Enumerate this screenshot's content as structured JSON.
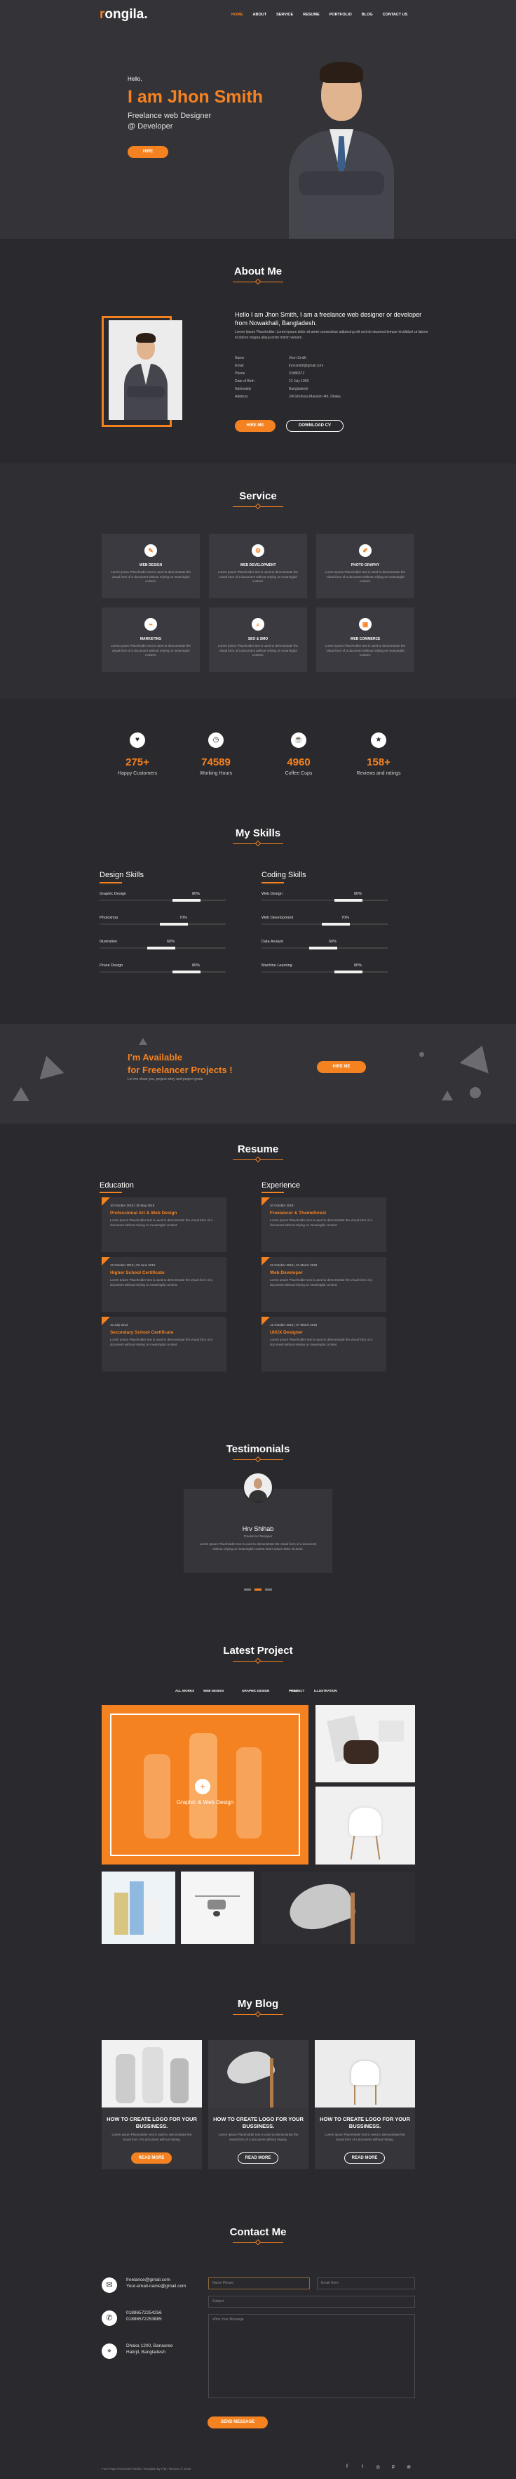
{
  "brand": {
    "logo_first": "r",
    "logo_rest": "ongila."
  },
  "nav": [
    "HOME",
    "ABOUT",
    "SERVICE",
    "RESUME",
    "PORTFOLIO",
    "BLOG",
    "CONTACT US"
  ],
  "hero": {
    "hello": "Hello,",
    "name": "I am Jhon Smith",
    "sub1": "Freelance web Designer",
    "sub2": "@ Developer",
    "button": "HIRE"
  },
  "about": {
    "title": "About Me",
    "intro": "Hello I am Jhon Smith, I am a freelance web designer or developer from Nowakhali, Bangladesh.",
    "text": "Lorem Ipsum Placeholder. Lorem ipsum dolor sit amet consectetur adipiscing elit sed do eiusmod tempor incididunt ut labore et dolore magna aliqua enim minim veniam.",
    "rows": [
      {
        "k": "Name",
        "v": "Jhon Smith"
      },
      {
        "k": "Email",
        "v": "jhonsmith@gmail.com"
      },
      {
        "k": "Phone",
        "v": "01886572"
      },
      {
        "k": "Date of Birth",
        "v": "12 July 1990"
      },
      {
        "k": "Nationality",
        "v": "Bangladeshi"
      },
      {
        "k": "Address",
        "v": "2/4 Ghohora Mansion 4th, Dhaka"
      }
    ],
    "btn1": "HIRE ME",
    "btn2": "DOWNLOAD CV"
  },
  "service": {
    "title": "Service",
    "desc": "Lorem Ipsum Placeholder text is used to demonstrate the visual form of a document without relying on meaningful content.",
    "items": [
      {
        "icon": "✎",
        "label": "WEB DESIGN"
      },
      {
        "icon": "⚙",
        "label": "WEB DEVELOPMENT"
      },
      {
        "icon": "✐",
        "label": "PHOTO GRAPHY"
      },
      {
        "icon": "⌁",
        "label": "MARKETING"
      },
      {
        "icon": "⌕",
        "label": "SEO & SMO"
      },
      {
        "icon": "▣",
        "label": "WEB COMMERCE"
      }
    ]
  },
  "counter": [
    {
      "icon": "♥",
      "n": "275+",
      "l": "Happy Customers"
    },
    {
      "icon": "◷",
      "n": "74589",
      "l": "Working Hours"
    },
    {
      "icon": "☕",
      "n": "4960",
      "l": "Coffee Cups"
    },
    {
      "icon": "★",
      "n": "158+",
      "l": "Reviews and ratings"
    }
  ],
  "skills": {
    "title": "My Skills",
    "design_title": "Design Skills",
    "coding_title": "Coding Skills",
    "design": [
      {
        "n": "Graphic Design",
        "p": "80%",
        "v": 0.8
      },
      {
        "n": "Photoshop",
        "p": "70%",
        "v": 0.7
      },
      {
        "n": "Illustration",
        "p": "60%",
        "v": 0.6
      },
      {
        "n": "Prune Design",
        "p": "80%",
        "v": 0.8
      }
    ],
    "coding": [
      {
        "n": "Web Design",
        "p": "80%",
        "v": 0.8
      },
      {
        "n": "Web Development",
        "p": "70%",
        "v": 0.7
      },
      {
        "n": "Data Analyst",
        "p": "60%",
        "v": 0.6
      },
      {
        "n": "Machine Learning",
        "p": "80%",
        "v": 0.8
      }
    ]
  },
  "free": {
    "t1": "I'm Available",
    "t2": "for Freelancer Projects !",
    "sub": "Let me show you, project story and project goals",
    "btn": "HIRE ME"
  },
  "resume": {
    "title": "Resume",
    "edu": "Education",
    "exp": "Experience",
    "desc": "Lorem Ipsum Placeholder text is used to demonstrate the visual form of a document without relying on meaningful content.",
    "education": [
      {
        "d": "10 October 2015 | 30 May 2016",
        "t": "Professional Art & Web Design"
      },
      {
        "d": "12 October 2013 | 02 June 2015",
        "t": "Higher School Certificate"
      },
      {
        "d": "10 July 2013",
        "t": "Secondary School Certificate"
      }
    ],
    "experience": [
      {
        "d": "20 October 2018",
        "t": "Freelancer & Themeforest"
      },
      {
        "d": "22 October 2016 | 21 March 2018",
        "t": "Web Developer"
      },
      {
        "d": "12 October 2014 | 07 March 2015",
        "t": "UI/UX Designer"
      }
    ]
  },
  "testi": {
    "title": "Testimonials",
    "name": "Hrv Shihab",
    "role": "Freelancer Designer",
    "text": "Lorem Ipsum Placeholder text is used to demonstrate the visual form of a document without relying on meaningful content lorem ipsum dolor sit amet."
  },
  "projects": {
    "title": "Latest Project",
    "filters": [
      "ALL WORKS",
      "WEB DESIGN",
      "GRAPHIC DESIGN",
      "PRINT",
      "PRODUCT",
      "ILLUSTRATION"
    ],
    "overlay": "Graphic & Web Design"
  },
  "blog": {
    "title": "My Blog",
    "post_title": "HOW TO CREATE LOGO FOR YOUR BUSSINESS.",
    "desc": "Lorem Ipsum Placeholder text is used to demonstrate the visual form of a document without relying.",
    "btn": "READ MORE"
  },
  "contact": {
    "title": "Contact Me",
    "email1": "freelance@gmail.com",
    "email2": "Your-email-name@gmail.com",
    "phone1": "01886572254256",
    "phone2": "01886572253885",
    "addr1": "Dhaka 1200, Banasree",
    "addr2": "Hatirjil, Bangladesh",
    "name_ph": "Name Please",
    "email_ph": "Email Here",
    "subject_ph": "Subject",
    "msg_ph": "Write Your Message",
    "btn": "SEND MESSAGE",
    "copy": "Free Page Personal Portfolio Template By Fiqh Themes © 2019"
  },
  "colors": {
    "accent": "#f58220",
    "bg": "#2a2a2e"
  }
}
